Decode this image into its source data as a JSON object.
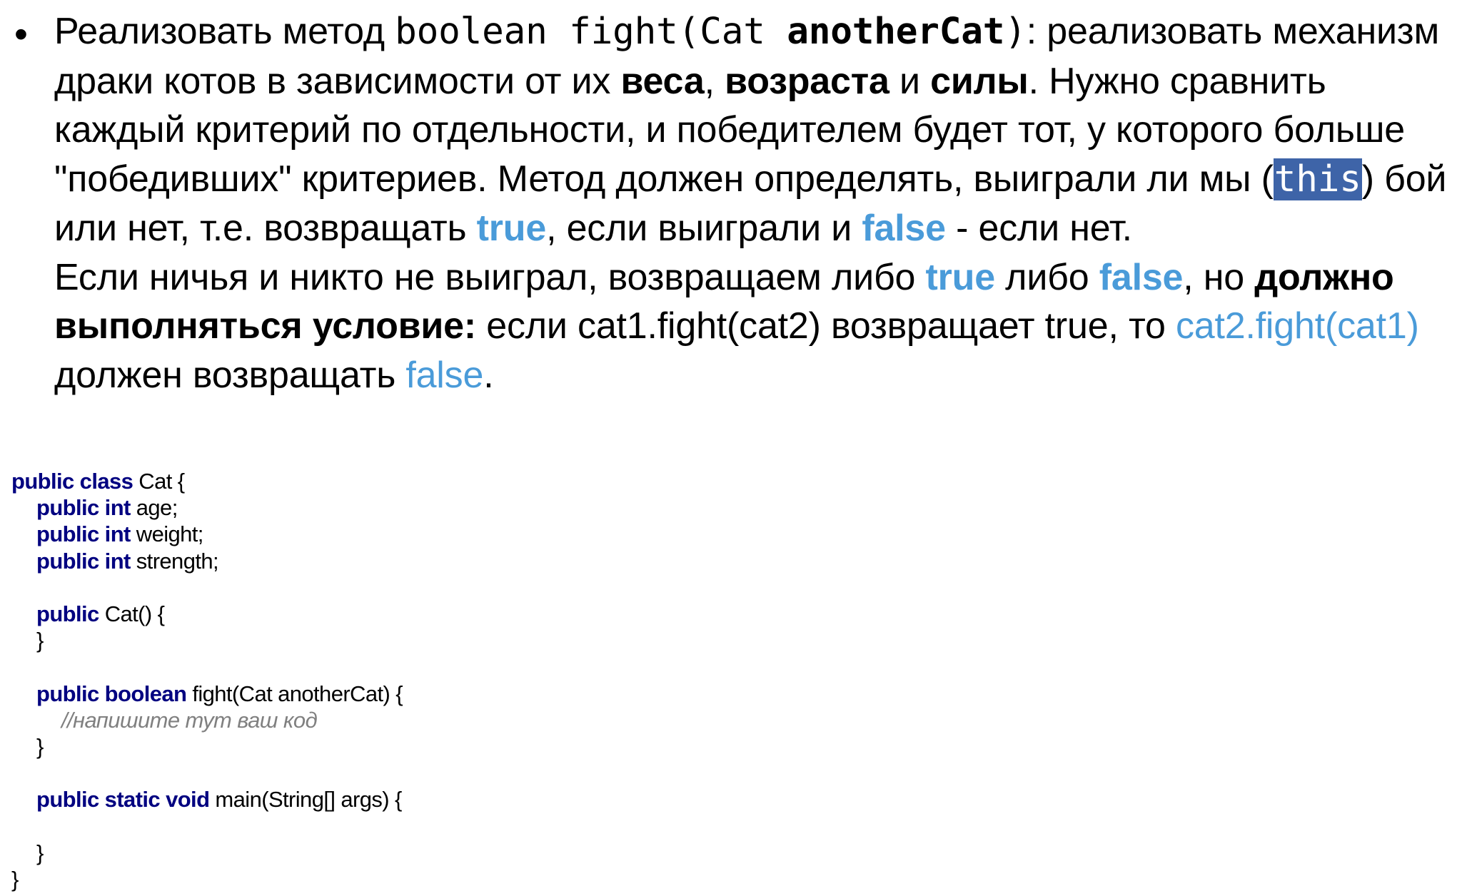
{
  "task": {
    "bullet": "•",
    "p1": {
      "t1": "Реализовать метод ",
      "code_sig": "boolean fight(Cat ",
      "code_arg": "anotherCat",
      "code_close": ")",
      "t2": ": реализовать механизм драки котов в зависимости от их ",
      "b_weight": "веса",
      "comma": ", ",
      "b_age": "возраста",
      "t3": " и ",
      "b_strength": "силы",
      "t4": ". Нужно сравнить каждый критерий по отдельности, и победителем будет тот, у которого больше \"победивших\" критериев. Метод должен определять, выиграли ли мы (",
      "this": "this",
      "t5": ") бой или нет, т.е. возвращать ",
      "true": "true",
      "t6": ", если выиграли и ",
      "false": "false",
      "t7": " - если нет."
    },
    "p2": {
      "t1": "Если ничья и никто не выиграл, возвращаем либо ",
      "true": "true",
      "t2": " либо ",
      "false": "false",
      "t3": ", но ",
      "b_condition": "должно выполняться условие:",
      "t4": " если cat1.fight(cat2) возвращает true, то ",
      "call2": "cat2.fight(cat1)",
      "t5": " должен возвращать ",
      "false2": "false",
      "t6": "."
    }
  },
  "code": {
    "l1_kw": "public class",
    "l1_rest": " Cat {",
    "l2_kw": "public int",
    "l2_rest": " age;",
    "l3_kw": "public int",
    "l3_rest": " weight;",
    "l4_kw": "public int",
    "l4_rest": " strength;",
    "l6_kw": "public",
    "l6_rest": " Cat() {",
    "l7": "}",
    "l9_kw": "public boolean",
    "l9_rest": " fight(Cat anotherCat) {",
    "l10_comment": "//напишите тут ваш код",
    "l11": "}",
    "l13_kw": "public static void",
    "l13_rest": " main(String[] args) {",
    "l15": "}",
    "l16": "}"
  }
}
